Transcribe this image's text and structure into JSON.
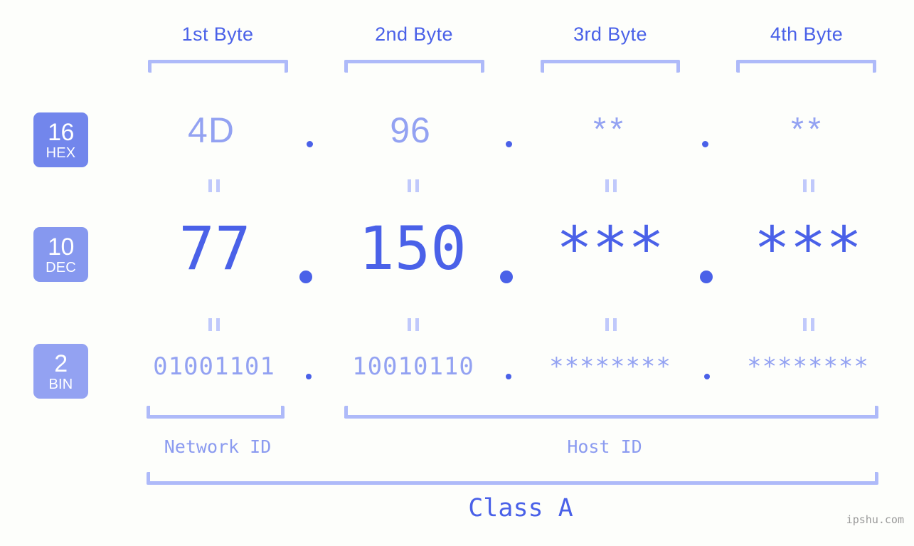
{
  "background_color": "#fdfefb",
  "colors": {
    "accent_dark": "#4a61e8",
    "accent_light": "#93a2f2",
    "bracket": "#aebaf9",
    "equals": "#c0c9fb",
    "badge_hex": "#7286ec",
    "badge_dec": "#8698ef",
    "badge_bin": "#93a2f2",
    "watermark": "#9a9a9a"
  },
  "byte_headers": [
    {
      "label": "1st Byte"
    },
    {
      "label": "2nd Byte"
    },
    {
      "label": "3rd Byte"
    },
    {
      "label": "4th Byte"
    }
  ],
  "bases": [
    {
      "number": "16",
      "abbr": "HEX"
    },
    {
      "number": "10",
      "abbr": "DEC"
    },
    {
      "number": "2",
      "abbr": "BIN"
    }
  ],
  "rows": {
    "hex": {
      "values": [
        "4D",
        "96",
        "**",
        "**"
      ]
    },
    "dec": {
      "values": [
        "77",
        "150",
        "***",
        "***"
      ]
    },
    "bin": {
      "values": [
        "01001101",
        "10010110",
        "********",
        "********"
      ]
    }
  },
  "separator": ".",
  "equals_symbol": "=",
  "footer": {
    "network_id_label": "Network ID",
    "host_id_label": "Host ID",
    "class_label": "Class A"
  },
  "watermark": "ipshu.com"
}
